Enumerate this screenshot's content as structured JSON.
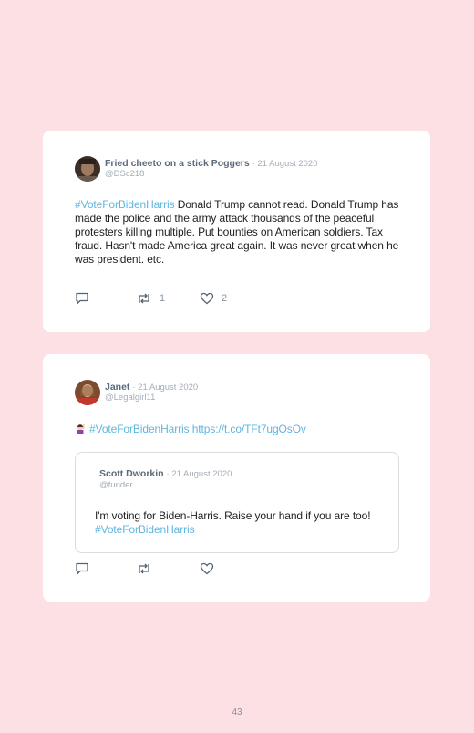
{
  "tweets": [
    {
      "author_name": "Fried cheeto on a stick Poggers",
      "date": "· 21 August 2020",
      "handle": "@DSc218",
      "hashtag": "#VoteForBidenHarris",
      "text": " Donald Trump cannot read. Donald Trump has made the police and the army attack thousands of the peaceful protesters killing multiple. Put bounties on American soldiers. Tax fraud. Hasn't made America great again. It was never great when he was president. etc.",
      "retweets": "1",
      "likes": "2",
      "icons": [
        "reply-icon",
        "retweet-icon",
        "heart-icon"
      ]
    },
    {
      "author_name": "Janet",
      "date": "· 21 August 2020",
      "handle": "@Legalgirl11",
      "emoji": "raising-hand-emoji",
      "hashtag": "#VoteForBidenHarris",
      "link": "https://t.co/TFt7ugOsOv",
      "quoted": {
        "author_name": "Scott Dworkin",
        "date": "· 21 August 2020",
        "handle": "@funder",
        "text": "I'm voting for Biden-Harris. Raise your hand if you are too! ",
        "hashtag": "#VoteForBidenHarris"
      },
      "icons": [
        "reply-icon",
        "retweet-icon",
        "heart-icon"
      ]
    }
  ],
  "page_number": "43",
  "colors": {
    "background": "#fde0e4",
    "hashtag": "#5fb6df",
    "card": "#ffffff"
  }
}
